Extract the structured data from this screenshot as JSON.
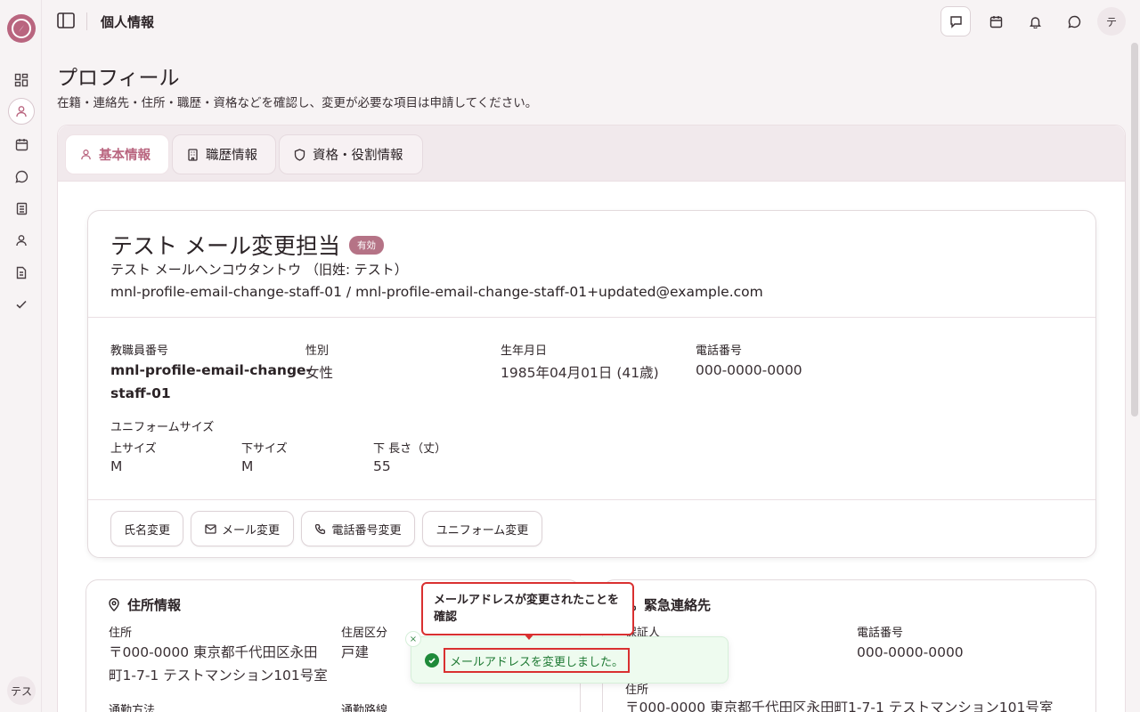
{
  "header": {
    "title": "個人情報",
    "avatar": "テ"
  },
  "rail": {
    "avatar": "テス"
  },
  "page": {
    "title": "プロフィール",
    "description": "在籍・連絡先・住所・職歴・資格などを確認し、変更が必要な項目は申請してください。"
  },
  "tabs": [
    {
      "label": "基本情報",
      "icon": "user-icon",
      "active": true
    },
    {
      "label": "職歴情報",
      "icon": "building-icon",
      "active": false
    },
    {
      "label": "資格・役割情報",
      "icon": "shield-icon",
      "active": false
    }
  ],
  "profile": {
    "name": "テスト メール変更担当",
    "status_badge": "有効",
    "kana": "テスト メールヘンコウタントウ （旧姓: テスト）",
    "email_line": "mnl-profile-email-change-staff-01 / mnl-profile-email-change-staff-01+updated@example.com",
    "fields": {
      "staff_no_label": "教職員番号",
      "staff_no_line1": "mnl-profile-email-change-",
      "staff_no_line2": "staff-01",
      "gender_label": "性別",
      "gender": "女性",
      "birth_label": "生年月日",
      "birth": "1985年04月01日 (41歳)",
      "phone_label": "電話番号",
      "phone": "000-0000-0000"
    },
    "uniform": {
      "label": "ユニフォームサイズ",
      "top_label": "上サイズ",
      "top": "M",
      "bottom_label": "下サイズ",
      "bottom": "M",
      "length_label": "下 長さ（丈）",
      "length": "55"
    },
    "actions": {
      "name_change": "氏名変更",
      "email_change": "メール変更",
      "phone_change": "電話番号変更",
      "uniform_change": "ユニフォーム変更"
    }
  },
  "address_card": {
    "title": "住所情報",
    "address_label": "住所",
    "address_line1": "〒000-0000 東京都千代田区永田",
    "address_line2": "町1-7-1 テストマンション101号室",
    "residence_label": "住居区分",
    "residence": "戸建",
    "commute_label": "通勤方法",
    "route_label": "通勤路線"
  },
  "emergency_card": {
    "title": "緊急連絡先",
    "guarantor_label": "保証人",
    "phone_label": "電話番号",
    "phone": "000-0000-0000",
    "address_label": "住所",
    "address": "〒000-0000 東京都千代田区永田町1-7-1 テストマンション101号室"
  },
  "toast": {
    "message": "メールアドレスを変更しました。",
    "close": "×"
  },
  "callout": {
    "text": "メールアドレスが変更されたことを確認"
  },
  "colors": {
    "accent": "#b9657f",
    "success": "#1f8a3a",
    "annotation": "#d93030"
  }
}
